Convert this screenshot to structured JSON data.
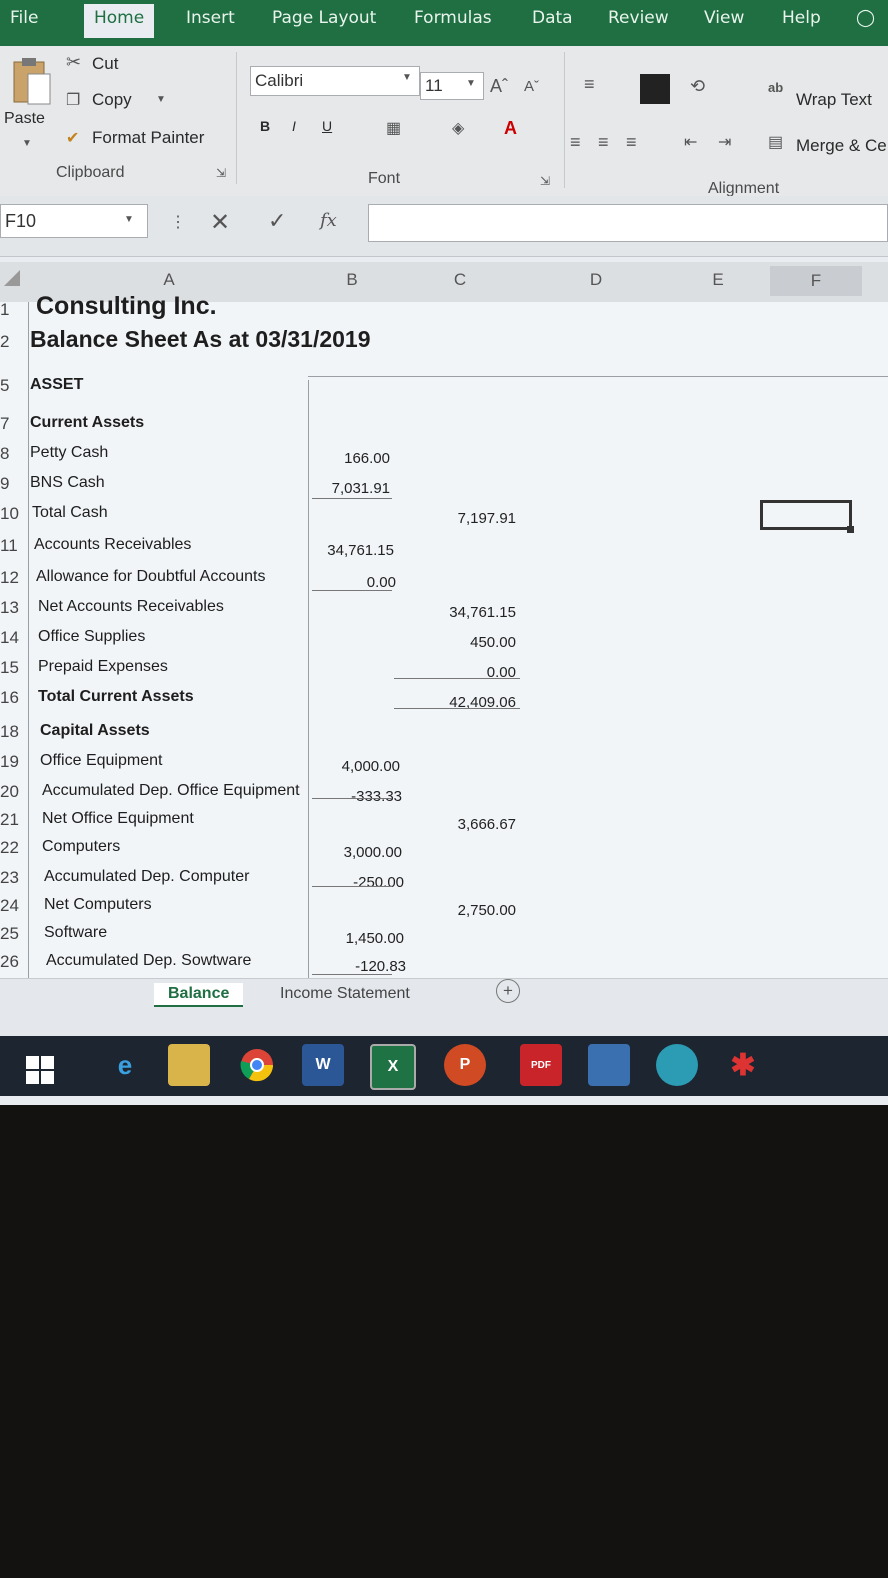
{
  "ribbon_tabs": [
    "File",
    "Home",
    "Insert",
    "Page Layout",
    "Formulas",
    "Data",
    "Review",
    "View",
    "Help"
  ],
  "clipboard": {
    "cut": "Cut",
    "copy": "Copy",
    "paste": "Paste",
    "format_painter": "Format Painter",
    "label": "Clipboard"
  },
  "font": {
    "name": "Calibri",
    "size": "11",
    "label": "Font",
    "bold": "B",
    "italic": "I",
    "underline": "U"
  },
  "alignment": {
    "wrap_text": "Wrap Text",
    "merge": "Merge & Ce",
    "label": "Alignment"
  },
  "formula_bar": {
    "name_box": "F10",
    "fx": "fx",
    "value": ""
  },
  "columns": [
    "A",
    "B",
    "C",
    "D",
    "E",
    "F"
  ],
  "title_rows": [
    {
      "row": "1",
      "text": "Consulting Inc."
    },
    {
      "row": "2",
      "text": "Balance Sheet As at 03/31/2019"
    }
  ],
  "rows": [
    {
      "row": "5",
      "a": "ASSET",
      "b": "",
      "c": ""
    },
    {
      "row": "7",
      "a": "Current Assets",
      "b": "",
      "c": ""
    },
    {
      "row": "8",
      "a": "Petty Cash",
      "b": "166.00",
      "c": ""
    },
    {
      "row": "9",
      "a": "BNS Cash",
      "b": "7,031.91",
      "c": ""
    },
    {
      "row": "10",
      "a": "Total Cash",
      "b": "",
      "c": "7,197.91"
    },
    {
      "row": "11",
      "a": "Accounts Receivables",
      "b": "34,761.15",
      "c": ""
    },
    {
      "row": "12",
      "a": "Allowance for Doubtful Accounts",
      "b": "0.00",
      "c": ""
    },
    {
      "row": "13",
      "a": "Net Accounts Receivables",
      "b": "",
      "c": "34,761.15"
    },
    {
      "row": "14",
      "a": "Office Supplies",
      "b": "",
      "c": "450.00"
    },
    {
      "row": "15",
      "a": "Prepaid Expenses",
      "b": "",
      "c": "0.00"
    },
    {
      "row": "16",
      "a": "Total Current Assets",
      "b": "",
      "c": "42,409.06"
    },
    {
      "row": "18",
      "a": "Capital Assets",
      "b": "",
      "c": ""
    },
    {
      "row": "19",
      "a": "Office Equipment",
      "b": "4,000.00",
      "c": ""
    },
    {
      "row": "20",
      "a": "Accumulated Dep. Office Equipment",
      "b": "-333.33",
      "c": ""
    },
    {
      "row": "21",
      "a": "Net Office Equipment",
      "b": "",
      "c": "3,666.67"
    },
    {
      "row": "22",
      "a": "Computers",
      "b": "3,000.00",
      "c": ""
    },
    {
      "row": "23",
      "a": "Accumulated Dep. Computer",
      "b": "-250.00",
      "c": ""
    },
    {
      "row": "24",
      "a": "Net Computers",
      "b": "",
      "c": "2,750.00"
    },
    {
      "row": "25",
      "a": "Software",
      "b": "1,450.00",
      "c": ""
    },
    {
      "row": "26",
      "a": "Accumulated Dep. Sowtware",
      "b": "-120.83",
      "c": ""
    }
  ],
  "sheet_tabs": [
    "Balance",
    "Income Statement"
  ],
  "taskbar": {
    "word": "W",
    "excel": "X",
    "powerpoint": "P",
    "pdf": "PDF"
  }
}
